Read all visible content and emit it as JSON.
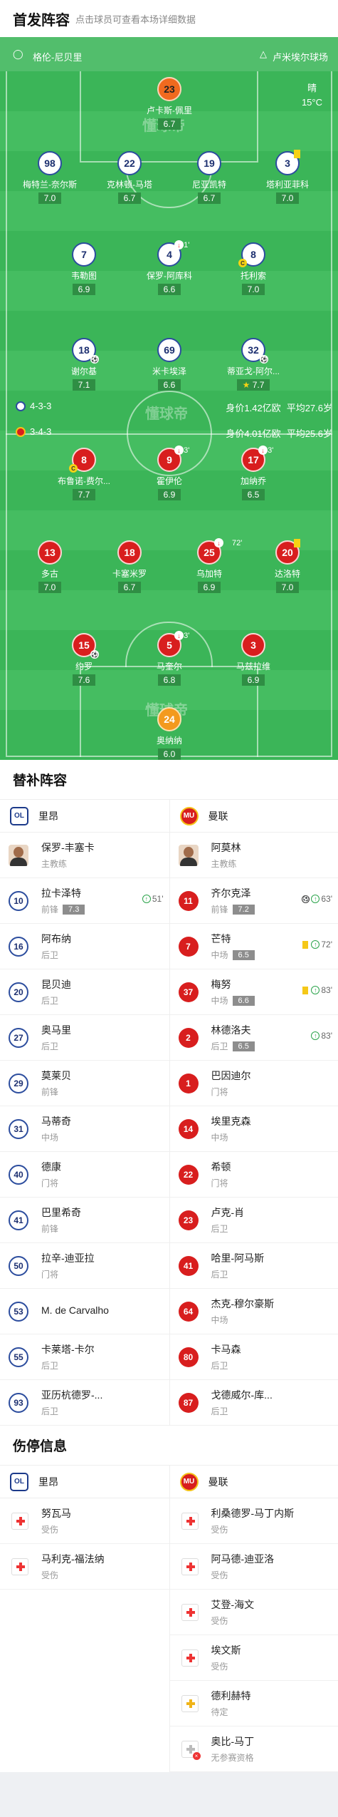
{
  "header": {
    "title": "首发阵容",
    "subtitle": "点击球员可查看本场详细数据"
  },
  "venue": {
    "left": "格伦-尼贝里",
    "right": "卢米埃尔球场"
  },
  "weather": {
    "desc": "晴",
    "temp": "15°C"
  },
  "lyon": {
    "formation": "4-3-3",
    "value": "身价1.42亿欧",
    "age": "平均27.6岁"
  },
  "mu": {
    "formation": "3-4-3",
    "value": "身价4.01亿欧",
    "age": "平均25.6岁"
  },
  "watermark": "懂球帝",
  "players": [
    {
      "num": "23",
      "name": "卢卡斯-佩里",
      "rating": "6.7"
    },
    {
      "num": "98",
      "name": "梅特兰-奈尔斯",
      "rating": "7.0"
    },
    {
      "num": "22",
      "name": "克林顿-马塔",
      "rating": "6.7"
    },
    {
      "num": "19",
      "name": "尼亚凯特",
      "rating": "6.7"
    },
    {
      "num": "3",
      "name": "塔利亚菲科",
      "rating": "7.0"
    },
    {
      "num": "7",
      "name": "韦勒图",
      "rating": "6.9"
    },
    {
      "num": "4",
      "name": "保罗-阿库科",
      "rating": "6.6",
      "min": "51'"
    },
    {
      "num": "8",
      "name": "托利索",
      "rating": "7.0"
    },
    {
      "num": "18",
      "name": "谢尔基",
      "rating": "7.1"
    },
    {
      "num": "69",
      "name": "米卡埃泽",
      "rating": "6.6"
    },
    {
      "num": "32",
      "name": "蒂亚戈-阿尔...",
      "rating": "7.7"
    },
    {
      "num": "8",
      "name": "布鲁诺-费尔...",
      "rating": "7.7"
    },
    {
      "num": "9",
      "name": "霍伊伦",
      "rating": "6.9",
      "min": "63'"
    },
    {
      "num": "17",
      "name": "加纳乔",
      "rating": "6.5",
      "min": "83'"
    },
    {
      "num": "13",
      "name": "多古",
      "rating": "7.0"
    },
    {
      "num": "18",
      "name": "卡塞米罗",
      "rating": "6.7"
    },
    {
      "num": "25",
      "name": "乌加特",
      "rating": "6.9",
      "min": "72'"
    },
    {
      "num": "20",
      "name": "达洛特",
      "rating": "7.0"
    },
    {
      "num": "15",
      "name": "约罗",
      "rating": "7.6"
    },
    {
      "num": "5",
      "name": "马奎尔",
      "rating": "6.8",
      "min": "83'"
    },
    {
      "num": "3",
      "name": "马兹拉维",
      "rating": "6.9"
    },
    {
      "num": "24",
      "name": "奥纳纳",
      "rating": "6.0"
    }
  ],
  "subs": {
    "title": "替补阵容",
    "lyon": {
      "team": "里昂",
      "crest": "OL",
      "coach": {
        "name": "保罗-丰塞卡",
        "role": "主教练"
      },
      "list": [
        {
          "num": "10",
          "name": "拉卡泽特",
          "pos": "前锋",
          "rating": "7.3",
          "ev": "51'"
        },
        {
          "num": "16",
          "name": "阿布纳",
          "pos": "后卫"
        },
        {
          "num": "20",
          "name": "昆贝迪",
          "pos": "后卫"
        },
        {
          "num": "27",
          "name": "奥马里",
          "pos": "后卫"
        },
        {
          "num": "29",
          "name": "莫莱贝",
          "pos": "前锋"
        },
        {
          "num": "31",
          "name": "马蒂奇",
          "pos": "中场"
        },
        {
          "num": "40",
          "name": "德康",
          "pos": "门将"
        },
        {
          "num": "41",
          "name": "巴里希奇",
          "pos": "前锋"
        },
        {
          "num": "50",
          "name": "拉辛-迪亚拉",
          "pos": "门将"
        },
        {
          "num": "53",
          "name": "M. de Carvalho",
          "pos": ""
        },
        {
          "num": "55",
          "name": "卡莱塔-卡尔",
          "pos": "后卫"
        },
        {
          "num": "93",
          "name": "亚历杭德罗-...",
          "pos": "后卫"
        }
      ]
    },
    "mu": {
      "team": "曼联",
      "crest": "MU",
      "coach": {
        "name": "阿莫林",
        "role": "主教练"
      },
      "list": [
        {
          "num": "11",
          "name": "齐尔克泽",
          "pos": "前锋",
          "rating": "7.2",
          "ev": "63'"
        },
        {
          "num": "7",
          "name": "芒特",
          "pos": "中场",
          "rating": "6.5",
          "ev": "72'"
        },
        {
          "num": "37",
          "name": "梅努",
          "pos": "中场",
          "rating": "6.6",
          "ev": "83'"
        },
        {
          "num": "2",
          "name": "林德洛夫",
          "pos": "后卫",
          "rating": "6.5",
          "ev": "83'"
        },
        {
          "num": "1",
          "name": "巴因迪尔",
          "pos": "门将"
        },
        {
          "num": "14",
          "name": "埃里克森",
          "pos": "中场"
        },
        {
          "num": "22",
          "name": "希顿",
          "pos": "门将"
        },
        {
          "num": "23",
          "name": "卢克-肖",
          "pos": "后卫"
        },
        {
          "num": "41",
          "name": "哈里-阿马斯",
          "pos": "后卫"
        },
        {
          "num": "64",
          "name": "杰克-穆尔豪斯",
          "pos": "中场"
        },
        {
          "num": "80",
          "name": "卡马森",
          "pos": "后卫"
        },
        {
          "num": "87",
          "name": "戈德威尔-库...",
          "pos": "后卫"
        }
      ]
    }
  },
  "injuries": {
    "title": "伤停信息",
    "lyon": {
      "team": "里昂",
      "list": [
        {
          "name": "努瓦马",
          "status": "受伤"
        },
        {
          "name": "马利克-福法纳",
          "status": "受伤"
        }
      ]
    },
    "mu": {
      "team": "曼联",
      "list": [
        {
          "name": "利桑德罗-马丁内斯",
          "status": "受伤"
        },
        {
          "name": "阿马德-迪亚洛",
          "status": "受伤"
        },
        {
          "name": "艾登-海文",
          "status": "受伤"
        },
        {
          "name": "埃文斯",
          "status": "受伤"
        },
        {
          "name": "德利赫特",
          "status": "待定"
        },
        {
          "name": "奥比-马丁",
          "status": "无参赛资格"
        }
      ]
    }
  }
}
